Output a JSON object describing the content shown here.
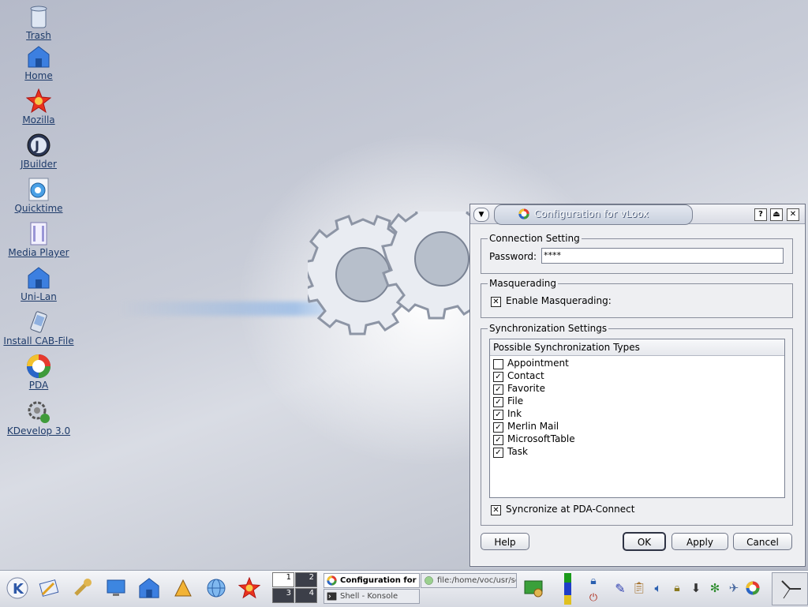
{
  "desktop": {
    "icons": [
      {
        "label": "Trash",
        "icon": "trash-icon"
      },
      {
        "label": "Home",
        "icon": "home-icon"
      },
      {
        "label": "Mozilla",
        "icon": "mozilla-icon"
      },
      {
        "label": "JBuilder",
        "icon": "jbuilder-icon"
      },
      {
        "label": "Quicktime",
        "icon": "quicktime-icon"
      },
      {
        "label": "Media Player",
        "icon": "media-player-icon"
      },
      {
        "label": "Uni-Lan",
        "icon": "uni-lan-icon"
      },
      {
        "label": "Install CAB-File",
        "icon": "install-cab-icon"
      },
      {
        "label": "PDA",
        "icon": "pda-icon"
      },
      {
        "label": "KDevelop 3.0",
        "icon": "kdevelop-icon"
      }
    ]
  },
  "dialog": {
    "title": "Configuration for vLoox",
    "connection": {
      "legend": "Connection Setting",
      "password_label": "Password:",
      "password_value": "****"
    },
    "masquerading": {
      "legend": "Masquerading",
      "enable_label": "Enable Masquerading:",
      "enable_checked": true
    },
    "sync": {
      "legend": "Synchronization Settings",
      "list_header": "Possible Synchronization Types",
      "types": [
        {
          "label": "Appointment",
          "checked": false
        },
        {
          "label": "Contact",
          "checked": true
        },
        {
          "label": "Favorite",
          "checked": true
        },
        {
          "label": "File",
          "checked": true
        },
        {
          "label": "Ink",
          "checked": true
        },
        {
          "label": "Merlin Mail",
          "checked": true
        },
        {
          "label": "MicrosoftTable",
          "checked": true
        },
        {
          "label": "Task",
          "checked": true
        }
      ],
      "connect_label": "Syncronize at PDA-Connect",
      "connect_checked": true
    },
    "buttons": {
      "help": "Help",
      "ok": "OK",
      "apply": "Apply",
      "cancel": "Cancel"
    }
  },
  "taskbar": {
    "pager": [
      "1",
      "2",
      "3",
      "4"
    ],
    "tasks": [
      {
        "label": "Configuration for vLoox",
        "active": true
      },
      {
        "label": "file:/home/voc/usr/sc",
        "active": false
      },
      {
        "label": "Shell - Konsole",
        "active": false
      }
    ]
  },
  "colors": {
    "desktop_link": "#1e3b6a",
    "titlebar_tab": "#c7cfdd",
    "dialog_bg": "#eeeff2"
  }
}
